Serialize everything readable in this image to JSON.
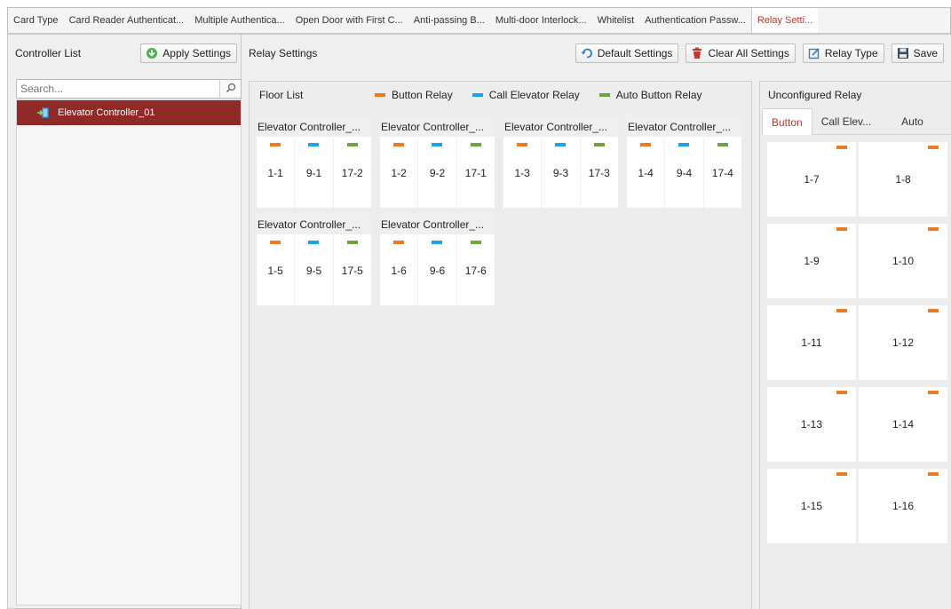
{
  "colors": {
    "button": "#f07b1f",
    "call": "#1aa3e8",
    "auto": "#6ea23a",
    "accent": "#c0392b",
    "selected_row": "#8f2a27"
  },
  "tabs": [
    {
      "label": "Card Type"
    },
    {
      "label": "Card Reader Authenticat..."
    },
    {
      "label": "Multiple Authentica..."
    },
    {
      "label": "Open Door with First C..."
    },
    {
      "label": "Anti-passing B..."
    },
    {
      "label": "Multi-door Interlock..."
    },
    {
      "label": "Whitelist"
    },
    {
      "label": "Authentication Passw..."
    },
    {
      "label": "Relay Setti..."
    }
  ],
  "left": {
    "title": "Controller List",
    "apply_label": "Apply Settings",
    "search_placeholder": "Search...",
    "tree_item": "Elevator Controller_01"
  },
  "mid": {
    "title": "Relay Settings",
    "buttons": {
      "default": "Default Settings",
      "clear": "Clear All Settings",
      "relay_type": "Relay Type",
      "save": "Save"
    }
  },
  "floor": {
    "title": "Floor List",
    "legend": {
      "button": "Button Relay",
      "call": "Call Elevator Relay",
      "auto": "Auto Button Relay"
    },
    "cards": [
      {
        "title": "Elevator Controller_...",
        "cells": [
          {
            "label": "1-1",
            "color": "#f07b1f"
          },
          {
            "label": "9-1",
            "color": "#1aa3e8"
          },
          {
            "label": "17-2",
            "color": "#6ea23a"
          }
        ]
      },
      {
        "title": "Elevator Controller_...",
        "cells": [
          {
            "label": "1-2",
            "color": "#f07b1f"
          },
          {
            "label": "9-2",
            "color": "#1aa3e8"
          },
          {
            "label": "17-1",
            "color": "#6ea23a"
          }
        ]
      },
      {
        "title": "Elevator Controller_...",
        "cells": [
          {
            "label": "1-3",
            "color": "#f07b1f"
          },
          {
            "label": "9-3",
            "color": "#1aa3e8"
          },
          {
            "label": "17-3",
            "color": "#6ea23a"
          }
        ]
      },
      {
        "title": "Elevator Controller_...",
        "cells": [
          {
            "label": "1-4",
            "color": "#f07b1f"
          },
          {
            "label": "9-4",
            "color": "#1aa3e8"
          },
          {
            "label": "17-4",
            "color": "#6ea23a"
          }
        ]
      },
      {
        "title": "Elevator Controller_...",
        "cells": [
          {
            "label": "1-5",
            "color": "#f07b1f"
          },
          {
            "label": "9-5",
            "color": "#1aa3e8"
          },
          {
            "label": "17-5",
            "color": "#6ea23a"
          }
        ]
      },
      {
        "title": "Elevator Controller_...",
        "cells": [
          {
            "label": "1-6",
            "color": "#f07b1f"
          },
          {
            "label": "9-6",
            "color": "#1aa3e8"
          },
          {
            "label": "17-6",
            "color": "#6ea23a"
          }
        ]
      }
    ]
  },
  "unconfigured": {
    "title": "Unconfigured Relay",
    "tabs": [
      {
        "label": "Button"
      },
      {
        "label": "Call Elev..."
      },
      {
        "label": "Auto"
      }
    ],
    "tiles": [
      {
        "label": "1-7"
      },
      {
        "label": "1-8"
      },
      {
        "label": "1-9"
      },
      {
        "label": "1-10"
      },
      {
        "label": "1-11"
      },
      {
        "label": "1-12"
      },
      {
        "label": "1-13"
      },
      {
        "label": "1-14"
      },
      {
        "label": "1-15"
      },
      {
        "label": "1-16"
      }
    ]
  }
}
